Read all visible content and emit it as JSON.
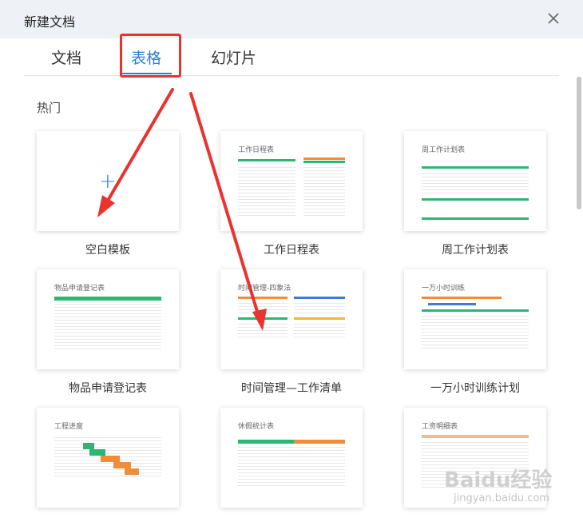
{
  "dialog": {
    "title": "新建文档"
  },
  "tabs": [
    {
      "label": "文档",
      "active": false
    },
    {
      "label": "表格",
      "active": true
    },
    {
      "label": "幻灯片",
      "active": false
    }
  ],
  "section": {
    "label": "热门"
  },
  "templates": [
    {
      "label": "空白模板",
      "thumb_title": ""
    },
    {
      "label": "工作日程表",
      "thumb_title": "工作日程表"
    },
    {
      "label": "周工作计划表",
      "thumb_title": "周工作计划表"
    },
    {
      "label": "物品申请登记表",
      "thumb_title": "物品申请登记表"
    },
    {
      "label": "时间管理—工作清单",
      "thumb_title": "时间管理-四象法"
    },
    {
      "label": "一万小时训练计划",
      "thumb_title": "一万小时训练"
    },
    {
      "label": "",
      "thumb_title": "工程进度"
    },
    {
      "label": "",
      "thumb_title": "休假统计表"
    },
    {
      "label": "",
      "thumb_title": "工资明细表"
    }
  ],
  "watermark": {
    "logo": "Baidu经验",
    "url": "jingyan.baidu.com"
  },
  "colors": {
    "accent": "#2b7cd8",
    "annotation": "#e8332f",
    "green": "#2bb673",
    "orange": "#f08c3a"
  }
}
